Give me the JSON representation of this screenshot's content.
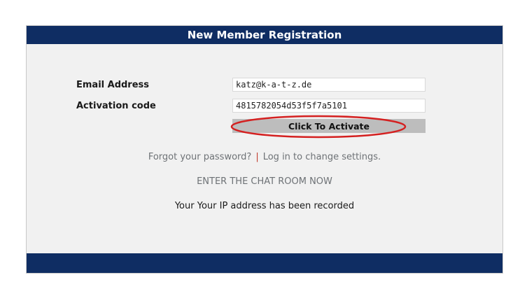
{
  "header": {
    "title": "New Member Registration"
  },
  "form": {
    "email_label": "Email Address",
    "email_value": "katz@k-a-t-z.de",
    "activation_label": "Activation code",
    "activation_value": "4815782054d53f5f7a5101",
    "activate_button": "Click To Activate"
  },
  "links": {
    "forgot_password": "Forgot your password?",
    "separator": "|",
    "login_settings": "Log in to change settings.",
    "chat_room": "ENTER THE CHAT ROOM NOW"
  },
  "notice": {
    "ip_recorded": "Your Your IP address has been recorded"
  },
  "colors": {
    "header_bg": "#0f2d63",
    "panel_bg": "#f1f1f1",
    "button_bg": "#bdbdbd",
    "highlight_ellipse": "#d42020"
  }
}
